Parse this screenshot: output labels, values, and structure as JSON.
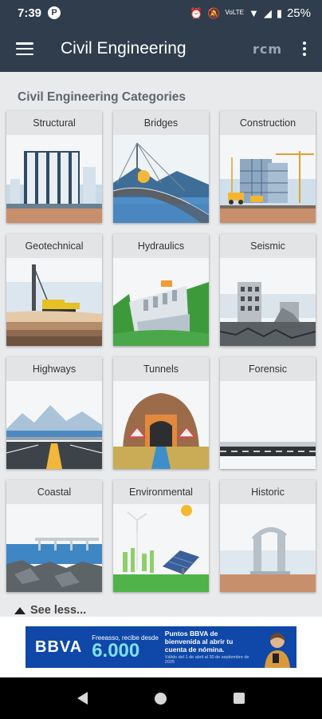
{
  "status_bar": {
    "time": "7:39",
    "app_icon_letter": "P",
    "battery": "25%",
    "icons": [
      "alarm-icon",
      "mute-icon",
      "volte-icon",
      "wifi-icon",
      "signal-icon",
      "battery-icon"
    ]
  },
  "app_bar": {
    "title": "Civil Engineering",
    "brand": "rcm"
  },
  "section_title": "Civil Engineering Categories",
  "categories": [
    {
      "label": "Structural"
    },
    {
      "label": "Bridges"
    },
    {
      "label": "Construction"
    },
    {
      "label": "Geotechnical"
    },
    {
      "label": "Hydraulics"
    },
    {
      "label": "Seismic"
    },
    {
      "label": "Highways"
    },
    {
      "label": "Tunnels"
    },
    {
      "label": "Forensic"
    },
    {
      "label": "Coastal"
    },
    {
      "label": "Environmental"
    },
    {
      "label": "Historic"
    }
  ],
  "see_less": "See less...",
  "ad": {
    "brand": "BBVA",
    "line1": "Freeasso, recibe desde",
    "amount": "6.000",
    "promo": "Puntos BBVA de bienvenida al abrir tu cuenta de nómina.",
    "valid": "Válido del 1 de abril al 30 de septiembre de 2025"
  },
  "colors": {
    "header": "#2f3d4d",
    "background": "#e9eaec",
    "card_label_bg": "#e3e4e6",
    "ad_blue": "#0f48a8",
    "ad_accent": "#7fe0f5"
  }
}
